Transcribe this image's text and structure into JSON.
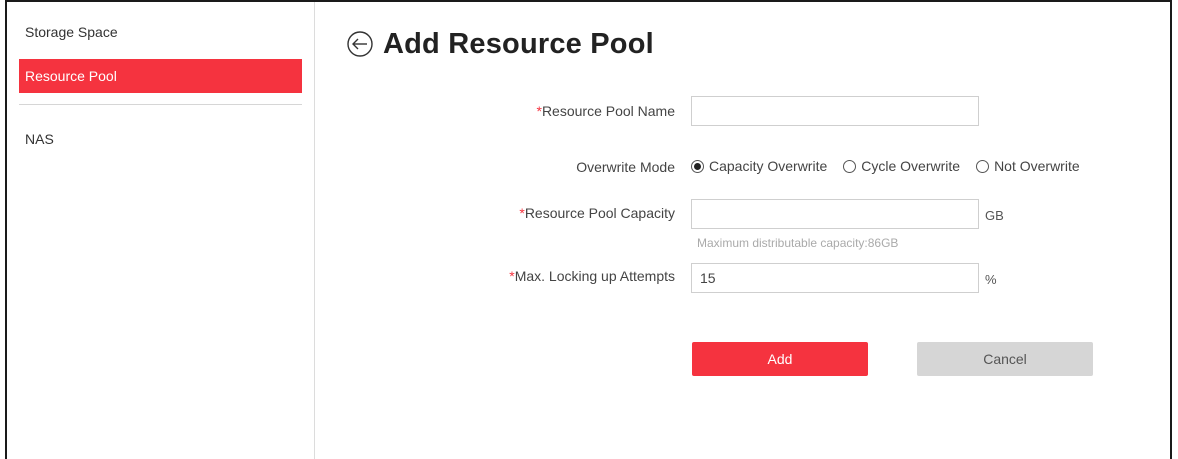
{
  "sidebar": {
    "items": [
      {
        "label": "Storage Space"
      },
      {
        "label": "Resource Pool"
      },
      {
        "label": "NAS"
      }
    ]
  },
  "page": {
    "title": "Add Resource Pool"
  },
  "form": {
    "pool_name": {
      "required_mark": "*",
      "label": "Resource Pool Name",
      "value": ""
    },
    "overwrite_mode": {
      "label": "Overwrite Mode",
      "options": [
        {
          "label": "Capacity Overwrite",
          "checked": true
        },
        {
          "label": "Cycle Overwrite",
          "checked": false
        },
        {
          "label": "Not Overwrite",
          "checked": false
        }
      ]
    },
    "capacity": {
      "required_mark": "*",
      "label": "Resource Pool Capacity",
      "value": "",
      "unit": "GB",
      "hint": "Maximum distributable capacity:86GB"
    },
    "locking": {
      "required_mark": "*",
      "label": "Max. Locking up Attempts",
      "value": "15",
      "unit": "%"
    }
  },
  "buttons": {
    "add": "Add",
    "cancel": "Cancel"
  },
  "colors": {
    "accent": "#f5333f",
    "cancel_bg": "#d6d6d6"
  },
  "icons": {
    "back": "back-arrow-circle-icon"
  }
}
